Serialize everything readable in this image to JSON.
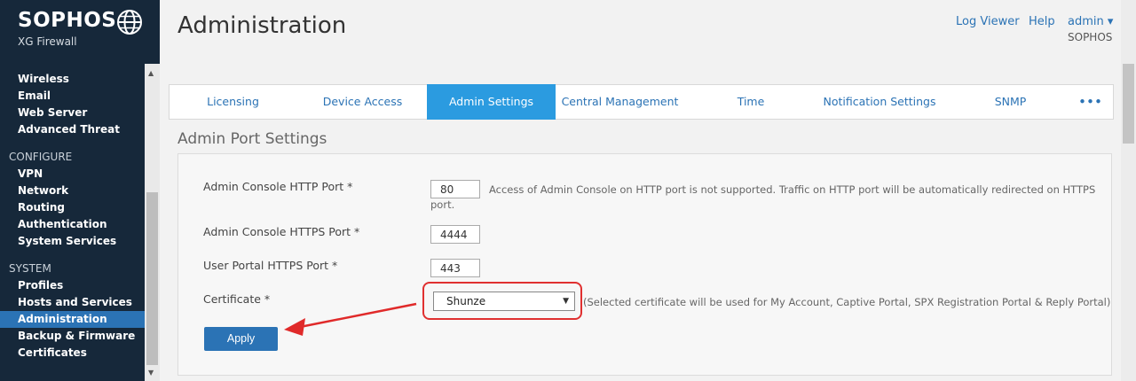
{
  "brand": {
    "name": "SOPHOS",
    "product": "XG Firewall"
  },
  "sidebar": {
    "groups": [
      {
        "section": "",
        "items": [
          "Wireless",
          "Email",
          "Web Server",
          "Advanced Threat"
        ]
      },
      {
        "section": "CONFIGURE",
        "items": [
          "VPN",
          "Network",
          "Routing",
          "Authentication",
          "System Services"
        ]
      },
      {
        "section": "SYSTEM",
        "items": [
          "Profiles",
          "Hosts and Services",
          "Administration",
          "Backup & Firmware",
          "Certificates"
        ]
      }
    ],
    "active_item": "Administration"
  },
  "header": {
    "title": "Administration",
    "links": {
      "log_viewer": "Log Viewer",
      "help": "Help",
      "user": "admin ▾"
    },
    "company": "SOPHOS"
  },
  "tabs": {
    "items": [
      "Licensing",
      "Device Access",
      "Admin Settings",
      "Central Management",
      "Time",
      "Notification Settings",
      "SNMP",
      "•••"
    ],
    "active": "Admin Settings"
  },
  "section": {
    "title": "Admin Port Settings",
    "http_label": "Admin Console HTTP Port *",
    "http_value": "80",
    "http_hint": "Access of Admin Console on HTTP port is not supported. Traffic on HTTP port will be automatically redirected on HTTPS port.",
    "https_label": "Admin Console HTTPS Port *",
    "https_value": "4444",
    "user_portal_label": "User Portal HTTPS Port *",
    "user_portal_value": "443",
    "cert_label": "Certificate *",
    "cert_value": "Shunze",
    "cert_hint": "(Selected certificate will be used for My Account, Captive Portal, SPX Registration Portal & Reply Portal)",
    "apply_label": "Apply"
  },
  "colors": {
    "sidebar_bg": "#16283a",
    "accent": "#2b73b5",
    "active_tab": "#2b9be0",
    "highlight": "#e03030"
  }
}
